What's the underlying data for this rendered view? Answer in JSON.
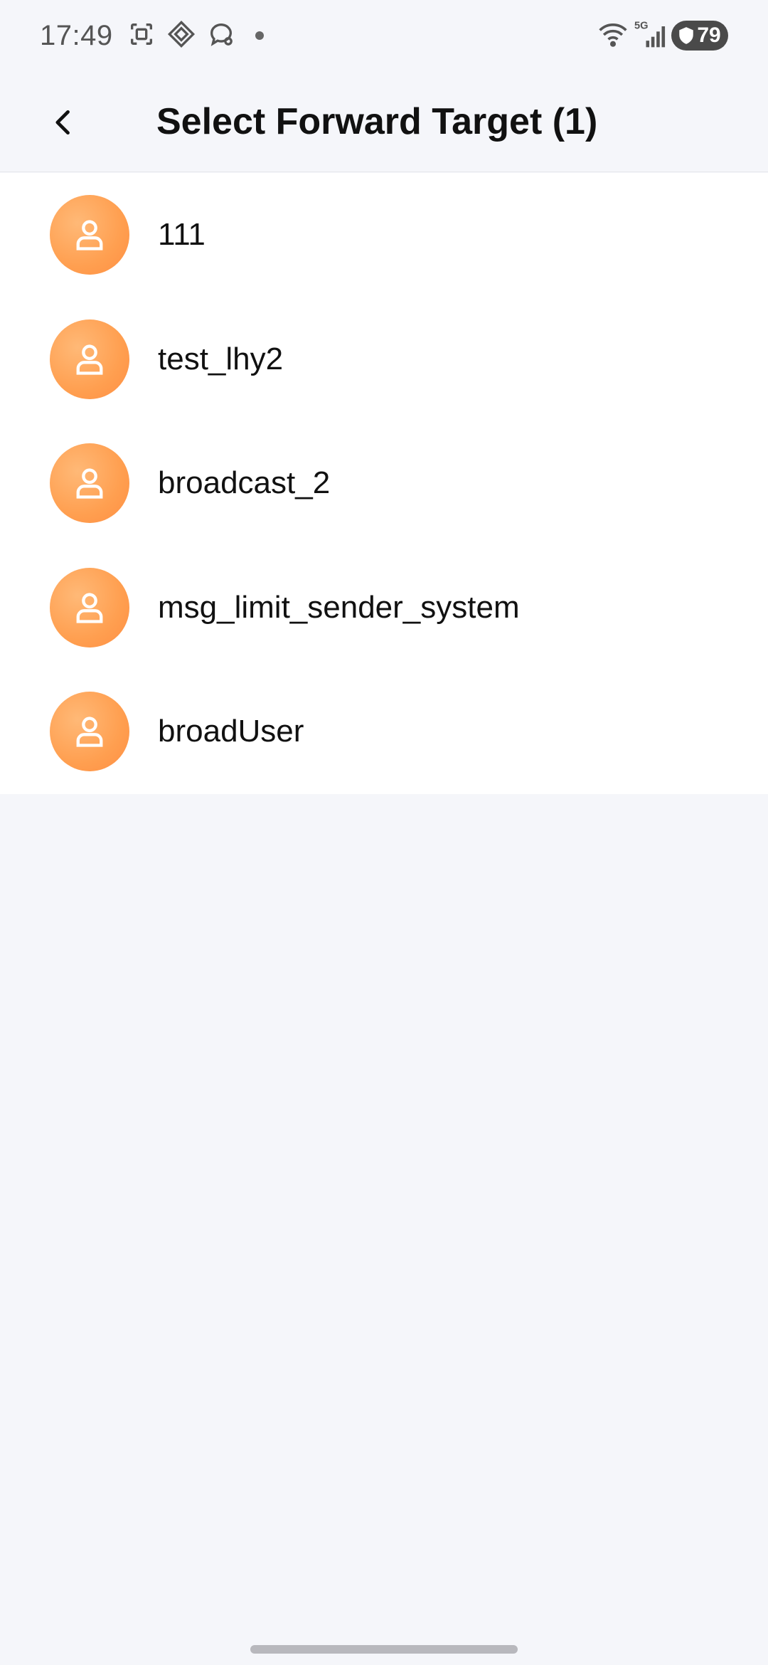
{
  "status_bar": {
    "time": "17:49",
    "network_label": "5G",
    "battery_level": "79",
    "icons": [
      "screenshot-icon",
      "app-grid-icon",
      "chat-bubble-icon",
      "wifi-icon",
      "signal-icon",
      "shield-icon"
    ]
  },
  "header": {
    "title": "Select Forward Target (1)"
  },
  "targets": [
    {
      "name": "111"
    },
    {
      "name": "test_lhy2"
    },
    {
      "name": "broadcast_2"
    },
    {
      "name": "msg_limit_sender_system"
    },
    {
      "name": "broadUser"
    }
  ],
  "colors": {
    "avatar": "#ff9f50",
    "background": "#f5f6fa",
    "list_background": "#ffffff"
  }
}
